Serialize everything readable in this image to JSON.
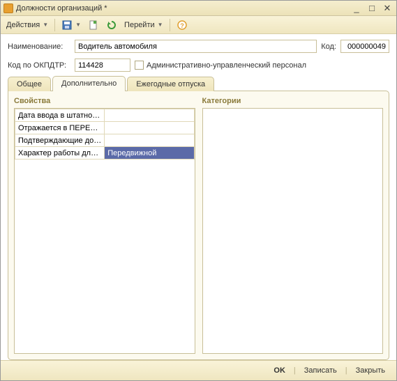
{
  "titlebar": {
    "title": "Должности организаций *"
  },
  "toolbar": {
    "actions_label": "Действия",
    "goto_label": "Перейти"
  },
  "form": {
    "name_label": "Наименование:",
    "name_value": "Водитель автомобиля",
    "code_label": "Код:",
    "code_value": "000000049",
    "okpdtr_label": "Код по ОКПДТР:",
    "okpdtr_value": "114428",
    "admin_chk_label": "Административно-управленческий персонал",
    "admin_chk_checked": false
  },
  "tabs": {
    "items": [
      {
        "label": "Общее",
        "active": false
      },
      {
        "label": "Дополнительно",
        "active": true
      },
      {
        "label": "Ежегодные отпуска",
        "active": false
      }
    ]
  },
  "panels": {
    "properties_title": "Свойства",
    "categories_title": "Категории"
  },
  "properties": {
    "rows": [
      {
        "name": "Дата ввода в штатное...",
        "value": ""
      },
      {
        "name": "Отражается в ПЕРЕЧ...",
        "value": ""
      },
      {
        "name": "Подтверждающие док...",
        "value": ""
      },
      {
        "name": "Характер работы для ...",
        "value": "Передвижной",
        "selected": true
      }
    ]
  },
  "footer": {
    "ok": "OK",
    "write": "Записать",
    "close": "Закрыть"
  }
}
